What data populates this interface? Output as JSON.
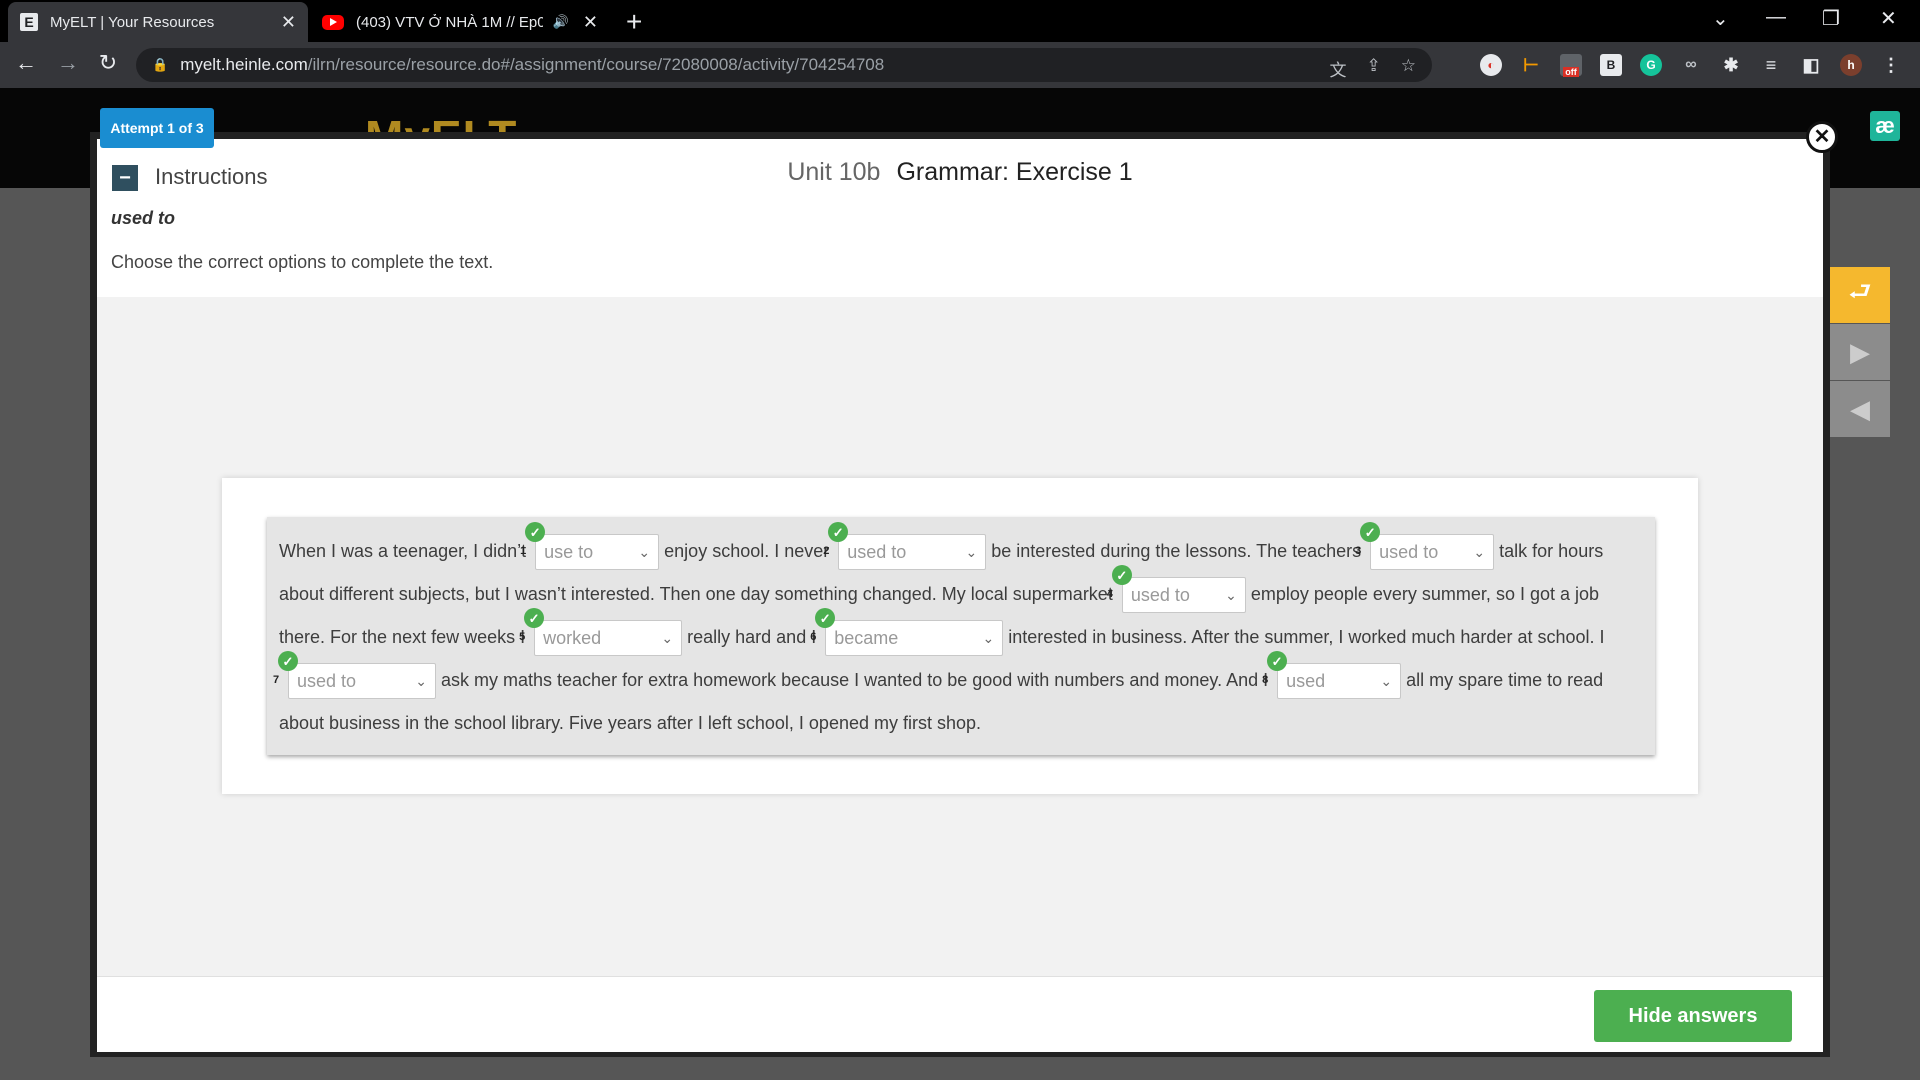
{
  "browser": {
    "tabs": [
      {
        "favicon": "E",
        "title": "MyELT | Your Resources"
      },
      {
        "favicon": "youtube-icon",
        "title": "(403) VTV Ở NHÀ 1M // Ep05"
      }
    ],
    "url_host": "myelt.heinle.com",
    "url_path": "/ilrn/resource/resource.do#/assignment/course/72080008/activity/704254708",
    "ext_off_label": "off",
    "profile_initial": "h"
  },
  "site": {
    "logo": "MyELT",
    "brand_icon": "æ"
  },
  "modal": {
    "attempt": "Attempt 1 of 3",
    "instructions_label": "Instructions",
    "unit": "Unit 10b",
    "exercise_title": "Grammar: Exercise 1",
    "topic": "used to",
    "direction": "Choose the correct options to complete the text.",
    "hide_answers": "Hide answers"
  },
  "passage": {
    "t0": "When I was a teenager, I didn’t",
    "t1": "enjoy school. I never",
    "t2": "be interested during the lessons. The teachers",
    "t3": "talk for hours about different subjects, but I wasn’t interested. Then one day something changed. My local supermarket",
    "t4": "employ people every summer, so I got a job there. For the next few weeks I",
    "t5": "really hard and I",
    "t6": "interested in business. After the summer, I worked much harder at school. I",
    "t7": "ask my maths teacher for extra homework because I wanted to be good with numbers and money. And I",
    "t8": "all my spare time to read about business in the school library. Five years after I left school, I opened my first shop."
  },
  "gaps": [
    {
      "num": "1",
      "value": "use to"
    },
    {
      "num": "2",
      "value": "used to"
    },
    {
      "num": "3",
      "value": "used to"
    },
    {
      "num": "4",
      "value": "used to"
    },
    {
      "num": "5",
      "value": "worked"
    },
    {
      "num": "6",
      "value": "became"
    },
    {
      "num": "7",
      "value": "used to"
    },
    {
      "num": "8",
      "value": "used"
    }
  ],
  "colors": {
    "correct": "#4caf50",
    "attempt_badge": "#1a8dd1",
    "tool_orange": "#f5b82e"
  }
}
